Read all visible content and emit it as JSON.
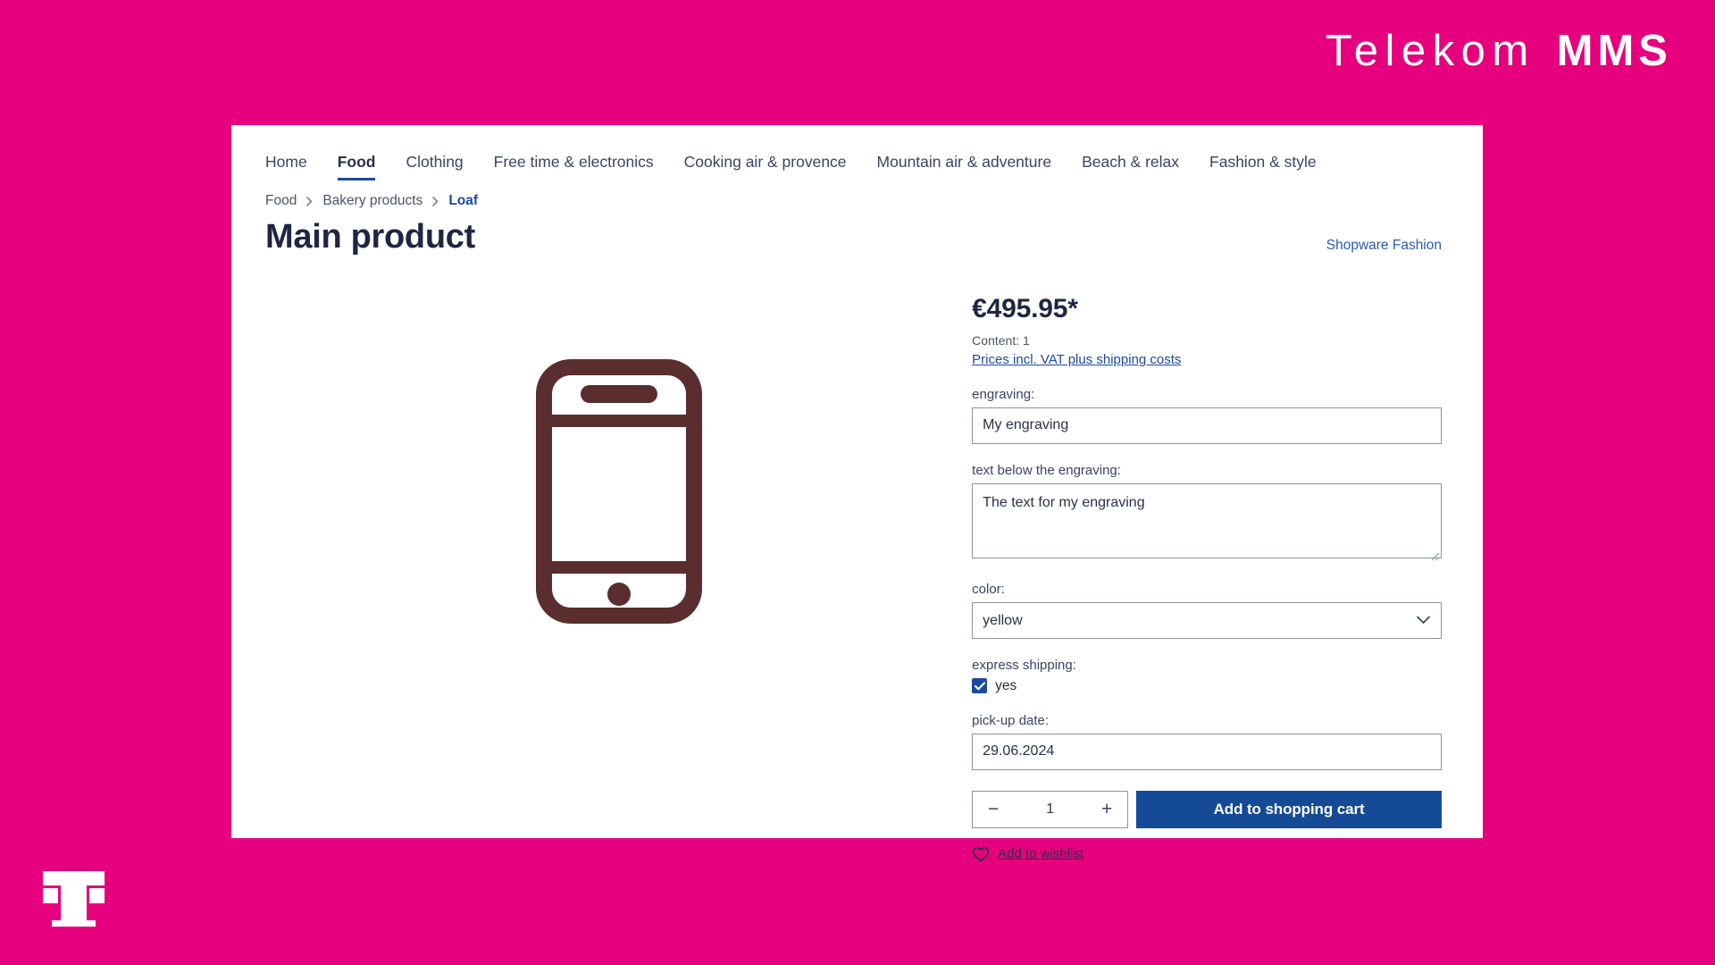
{
  "brand": {
    "word": "Telekom",
    "mms": "MMS",
    "magenta": "#e6007e",
    "logo_alt": "telekom-t-logo"
  },
  "nav": {
    "items": [
      {
        "label": "Home",
        "active": false
      },
      {
        "label": "Food",
        "active": true
      },
      {
        "label": "Clothing",
        "active": false
      },
      {
        "label": "Free time & electronics",
        "active": false
      },
      {
        "label": "Cooking air & provence",
        "active": false
      },
      {
        "label": "Mountain air & adventure",
        "active": false
      },
      {
        "label": "Beach & relax",
        "active": false
      },
      {
        "label": "Fashion & style",
        "active": false
      }
    ]
  },
  "breadcrumb": {
    "separator": "›",
    "items": [
      {
        "label": "Food",
        "current": false
      },
      {
        "label": "Bakery products",
        "current": false
      },
      {
        "label": "Loaf",
        "current": true
      }
    ]
  },
  "header": {
    "title": "Main product",
    "manufacturer_link": "Shopware Fashion"
  },
  "gallery": {
    "image_alt": "smartphone-product-image",
    "image_color": "#5a2e2e"
  },
  "buybox": {
    "price": "€495.95*",
    "content_line": "Content: 1",
    "tax_link": "Prices incl. VAT plus shipping costs",
    "fields": {
      "engraving": {
        "label": "engraving:",
        "value": "My engraving",
        "placeholder": ""
      },
      "text_below_engraving": {
        "label": "text below the engraving:",
        "value": "The text for my engraving",
        "placeholder": ""
      },
      "color": {
        "label": "color:",
        "selected": "yellow",
        "options": [
          "yellow"
        ]
      },
      "express_shipping": {
        "label": "express shipping:",
        "checkbox_label": "yes",
        "checked": true
      },
      "pickup_date": {
        "label": "pick-up date:",
        "value": "29.06.2024",
        "placeholder": ""
      }
    },
    "quantity": {
      "decrease_label": "−",
      "value": "1",
      "increase_label": "+"
    },
    "add_to_cart_label": "Add to shopping cart",
    "wishlist_label": "Add to wishlist",
    "accent_blue": "#154a96"
  }
}
